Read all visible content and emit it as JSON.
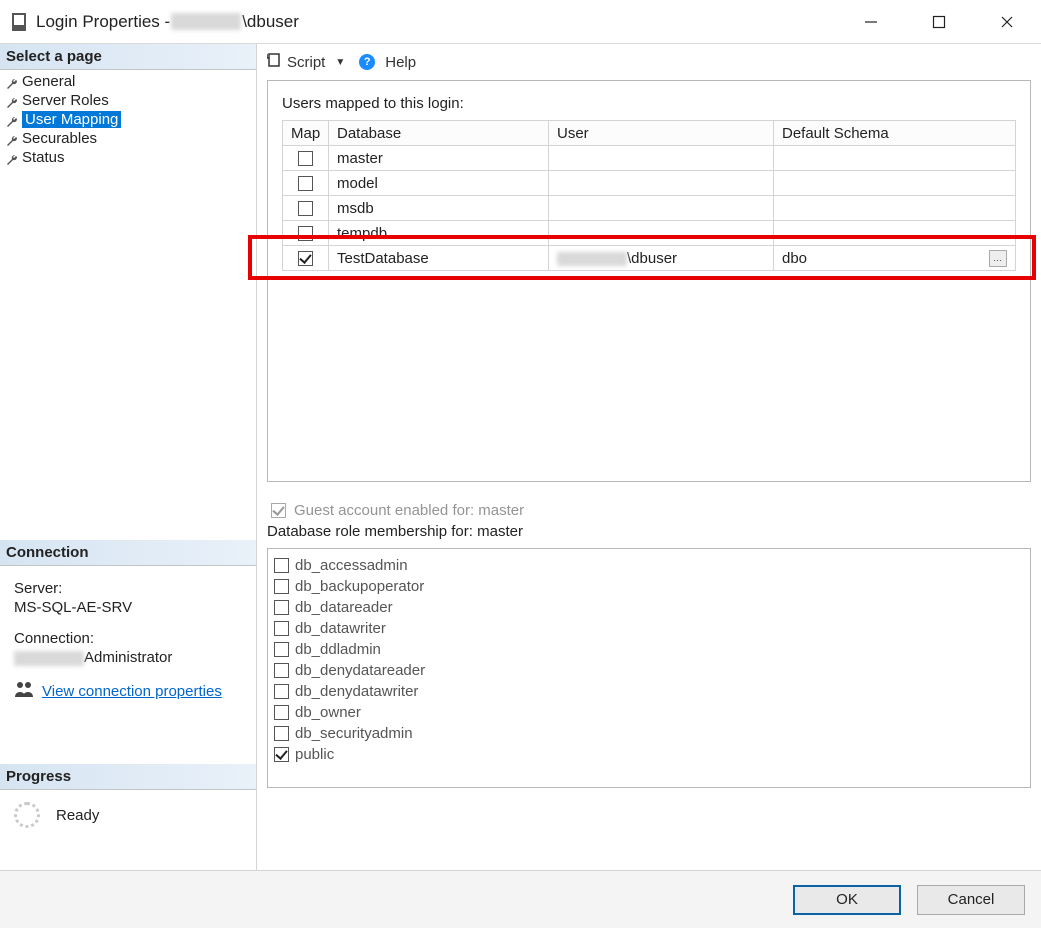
{
  "title": {
    "prefix": "Login Properties - ",
    "redacted": true,
    "suffix": "\\dbuser"
  },
  "sidebar": {
    "select_page_header": "Select a page",
    "pages": [
      {
        "label": "General",
        "selected": false
      },
      {
        "label": "Server Roles",
        "selected": false
      },
      {
        "label": "User Mapping",
        "selected": true
      },
      {
        "label": "Securables",
        "selected": false
      },
      {
        "label": "Status",
        "selected": false
      }
    ],
    "connection_header": "Connection",
    "connection": {
      "server_label": "Server:",
      "server_value": "MS-SQL-AE-SRV",
      "connection_label": "Connection:",
      "connection_value_suffix": "Administrator",
      "connection_redacted": true,
      "view_link": "View connection properties"
    },
    "progress_header": "Progress",
    "progress_status": "Ready"
  },
  "toolbar": {
    "script_label": "Script",
    "help_label": "Help"
  },
  "mapping": {
    "label": "Users mapped to this login:",
    "columns": {
      "map": "Map",
      "database": "Database",
      "user": "User",
      "schema": "Default Schema"
    },
    "rows": [
      {
        "checked": false,
        "database": "master",
        "user": "",
        "schema": ""
      },
      {
        "checked": false,
        "database": "model",
        "user": "",
        "schema": ""
      },
      {
        "checked": false,
        "database": "msdb",
        "user": "",
        "schema": ""
      },
      {
        "checked": false,
        "database": "tempdb",
        "user": "",
        "schema": ""
      },
      {
        "checked": true,
        "database": "TestDatabase",
        "user_redacted": true,
        "user_suffix": "\\dbuser",
        "schema": "dbo",
        "has_ellipsis": true
      }
    ],
    "highlight_row_index": 4
  },
  "guest": {
    "label_prefix": "Guest account enabled for: ",
    "db": "master",
    "checked": true,
    "disabled": true
  },
  "roles": {
    "label_prefix": "Database role membership for: ",
    "db": "master",
    "items": [
      {
        "label": "db_accessadmin",
        "checked": false
      },
      {
        "label": "db_backupoperator",
        "checked": false
      },
      {
        "label": "db_datareader",
        "checked": false
      },
      {
        "label": "db_datawriter",
        "checked": false
      },
      {
        "label": "db_ddladmin",
        "checked": false
      },
      {
        "label": "db_denydatareader",
        "checked": false
      },
      {
        "label": "db_denydatawriter",
        "checked": false
      },
      {
        "label": "db_owner",
        "checked": false
      },
      {
        "label": "db_securityadmin",
        "checked": false
      },
      {
        "label": "public",
        "checked": true
      }
    ]
  },
  "buttons": {
    "ok": "OK",
    "cancel": "Cancel"
  }
}
